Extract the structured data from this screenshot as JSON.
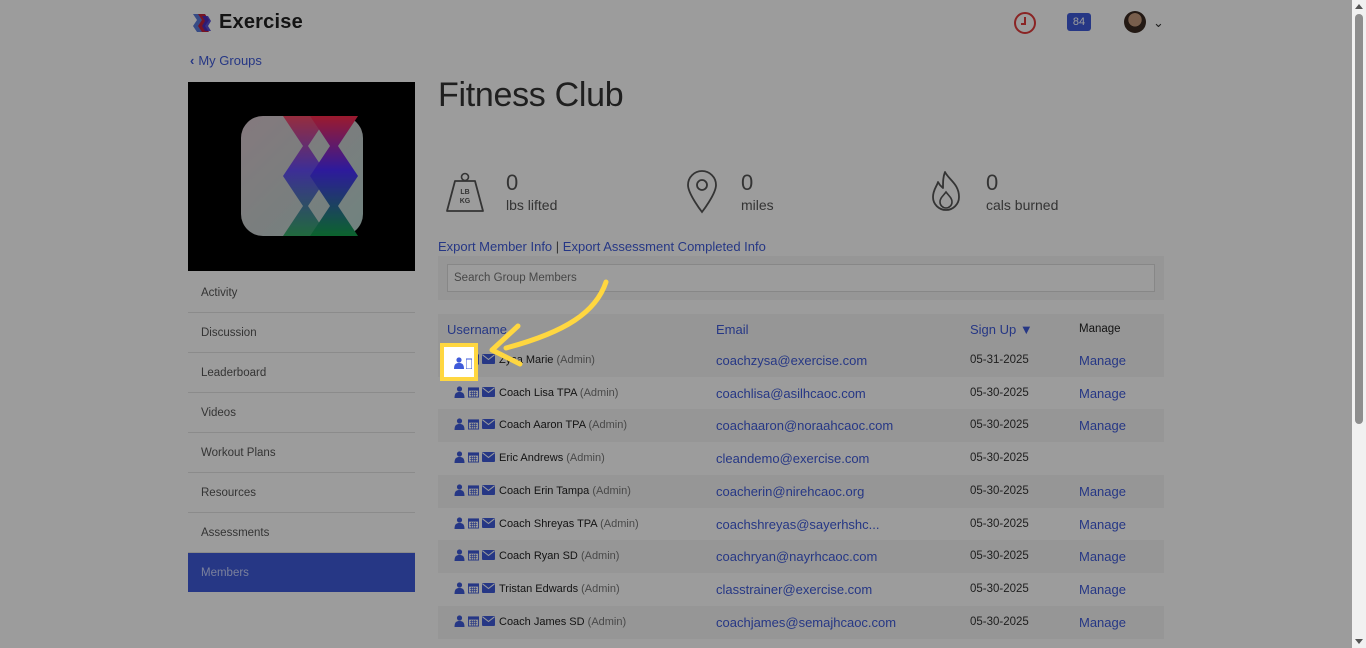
{
  "app": {
    "name": "Exercise",
    "notification_count": "84"
  },
  "nav": {
    "back_label": "My Groups"
  },
  "sidebar": {
    "items": [
      {
        "label": "Activity"
      },
      {
        "label": "Discussion"
      },
      {
        "label": "Leaderboard"
      },
      {
        "label": "Videos"
      },
      {
        "label": "Workout Plans"
      },
      {
        "label": "Resources"
      },
      {
        "label": "Assessments"
      },
      {
        "label": "Members",
        "active": true
      }
    ]
  },
  "group": {
    "title": "Fitness Club",
    "stats": [
      {
        "icon": "weight-icon",
        "value": "0",
        "label": "lbs lifted",
        "icon_text": "LB KG"
      },
      {
        "icon": "location-pin-icon",
        "value": "0",
        "label": "miles"
      },
      {
        "icon": "flame-icon",
        "value": "0",
        "label": "cals burned"
      }
    ]
  },
  "exports": {
    "member_info": "Export Member Info",
    "separator": "|",
    "assessment_info": "Export Assessment Completed Info"
  },
  "search": {
    "placeholder": "Search Group Members"
  },
  "table": {
    "headers": {
      "username": "Username",
      "email": "Email",
      "signup": "Sign Up ▼",
      "manage": "Manage"
    },
    "rows": [
      {
        "name": "Zysa Marie",
        "role": "(Admin)",
        "email": "coachzysa@exercise.com",
        "date": "05-31-2025",
        "manage": "Manage"
      },
      {
        "name": "Coach Lisa TPA",
        "role": "(Admin)",
        "email": "coachlisa@asilhcaoc.com",
        "date": "05-30-2025",
        "manage": "Manage"
      },
      {
        "name": "Coach Aaron TPA",
        "role": "(Admin)",
        "email": "coachaaron@noraahcaoc.com",
        "date": "05-30-2025",
        "manage": "Manage"
      },
      {
        "name": "Eric Andrews",
        "role": "(Admin)",
        "email": "cleandemo@exercise.com",
        "date": "05-30-2025",
        "manage": ""
      },
      {
        "name": "Coach Erin Tampa",
        "role": "(Admin)",
        "email": "coacherin@nirehcaoc.org",
        "date": "05-30-2025",
        "manage": "Manage"
      },
      {
        "name": "Coach Shreyas TPA",
        "role": "(Admin)",
        "email": "coachshreyas@sayerhshc...",
        "date": "05-30-2025",
        "manage": "Manage"
      },
      {
        "name": "Coach Ryan SD",
        "role": "(Admin)",
        "email": "coachryan@nayrhcaoc.com",
        "date": "05-30-2025",
        "manage": "Manage"
      },
      {
        "name": "Tristan Edwards",
        "role": "(Admin)",
        "email": "classtrainer@exercise.com",
        "date": "05-30-2025",
        "manage": "Manage"
      },
      {
        "name": "Coach James SD",
        "role": "(Admin)",
        "email": "coachjames@semajhcaoc.com",
        "date": "05-30-2025",
        "manage": "Manage"
      }
    ]
  },
  "colors": {
    "accent": "#3f5bd9",
    "highlight": "#ffd740",
    "alert": "#e23b3b"
  }
}
